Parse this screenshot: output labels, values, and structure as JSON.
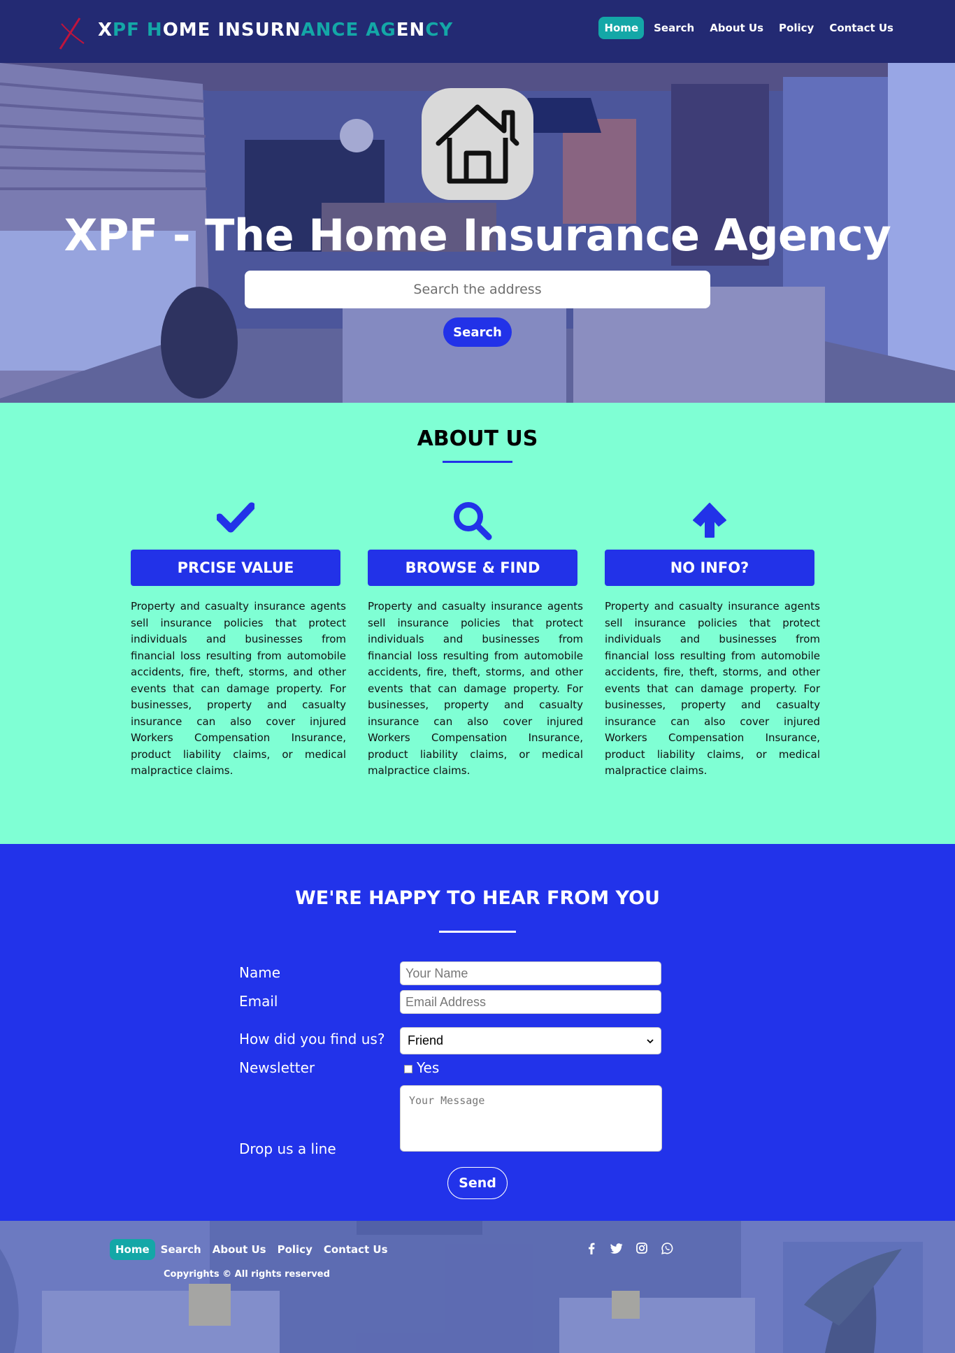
{
  "nav": {
    "brand": {
      "parts": [
        {
          "text": "X",
          "color": "white"
        },
        {
          "text": "PF H",
          "color": "teal"
        },
        {
          "text": "OME INSURN",
          "color": "white"
        },
        {
          "text": "ANCE AG",
          "color": "teal"
        },
        {
          "text": "EN",
          "color": "white"
        },
        {
          "text": "CY",
          "color": "teal"
        }
      ]
    },
    "links": [
      "Home",
      "Search",
      "About Us",
      "Policy",
      "Contact Us"
    ],
    "active": "Home"
  },
  "hero": {
    "title": "XPF - The Home Insurance Agency",
    "search_placeholder": "Search the address",
    "search_button": "Search",
    "icon": "house-icon"
  },
  "about": {
    "title": "ABOUT US",
    "cards": [
      {
        "icon": "check-icon",
        "heading": "PRCISE VALUE",
        "text": "Property and casualty insurance agents sell insurance policies that protect individuals and businesses from financial loss resulting from automobile accidents, fire, theft, storms, and other events that can damage property. For businesses, property and casualty insurance can also cover injured Workers Compensation Insurance, product liability claims, or medical malpractice claims."
      },
      {
        "icon": "magnifier-icon",
        "heading": "BROWSE & FIND",
        "text": "Property and casualty insurance agents sell insurance policies that protect individuals and businesses from financial loss resulting from automobile accidents, fire, theft, storms, and other events that can damage property. For businesses, property and casualty insurance can also cover injured Workers Compensation Insurance, product liability claims, or medical malpractice claims."
      },
      {
        "icon": "arrow-up-icon",
        "heading": "NO INFO?",
        "text": "Property and casualty insurance agents sell insurance policies that protect individuals and businesses from financial loss resulting from automobile accidents, fire, theft, storms, and other events that can damage property. For businesses, property and casualty insurance can also cover injured Workers Compensation Insurance, product liability claims, or medical malpractice claims."
      }
    ]
  },
  "contact": {
    "title": "WE'RE HAPPY TO HEAR FROM YOU",
    "name_label": "Name",
    "name_placeholder": "Your Name",
    "email_label": "Email",
    "email_placeholder": "Email Address",
    "source_label": "How did you find us?",
    "source_value": "Friend",
    "newsletter_label": "Newsletter",
    "newsletter_option": "Yes",
    "message_label": "Drop us a line",
    "message_placeholder": "Your Message",
    "send_button": "Send"
  },
  "footer": {
    "links": [
      "Home",
      "Search",
      "About Us",
      "Policy",
      "Contact Us"
    ],
    "active": "Home",
    "copyright": "Copyrights © All rights reserved",
    "social": [
      "facebook-icon",
      "twitter-icon",
      "instagram-icon",
      "whatsapp-icon"
    ]
  },
  "colors": {
    "navbar": "#232a73",
    "accent_teal": "#14a7a7",
    "primary_blue": "#2232e8",
    "about_bg": "#7fffd4"
  }
}
